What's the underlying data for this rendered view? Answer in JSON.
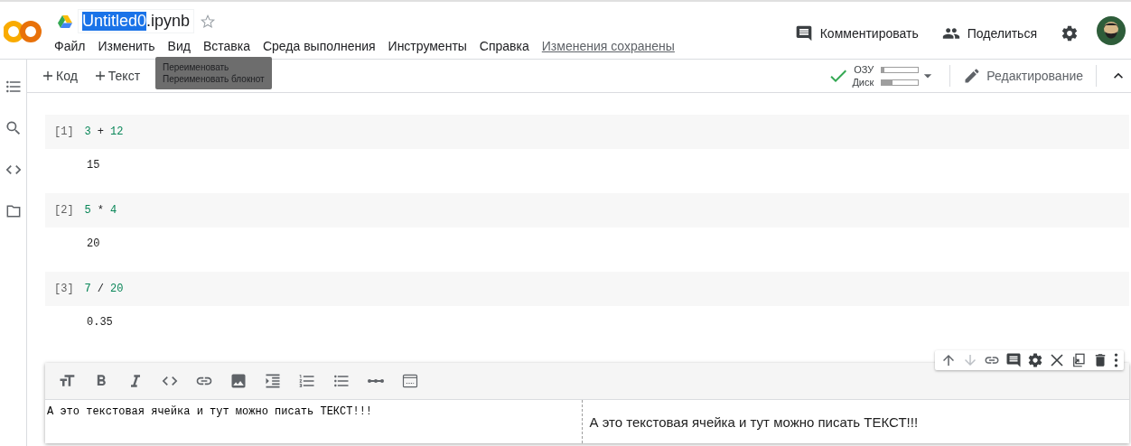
{
  "header": {
    "file_name": "Untitled0",
    "file_extension": ".ipynb",
    "name_selected": true,
    "starred": false,
    "menu": [
      "Файл",
      "Изменить",
      "Вид",
      "Вставка",
      "Среда выполнения",
      "Инструменты",
      "Справка"
    ],
    "save_status": "Изменения сохранены",
    "tooltip": [
      "Переименовать",
      "Переименовать блокнот"
    ],
    "actions": [
      {
        "kind": "comment",
        "label": "Комментировать"
      },
      {
        "kind": "share",
        "label": "Поделиться"
      }
    ]
  },
  "toolbar": {
    "add_buttons": [
      {
        "label": "Код"
      },
      {
        "label": "Текст"
      }
    ],
    "resources": [
      {
        "label": "ОЗУ",
        "level": 0.06
      },
      {
        "label": "Диск",
        "level": 0.3
      }
    ],
    "connected": true,
    "mode": "Редактирование"
  },
  "cells": [
    {
      "kind": "code",
      "counter": "[1]",
      "code": [
        {
          "t": "3",
          "kind": "number"
        },
        {
          "t": "+",
          "kind": "operator"
        },
        {
          "t": "12",
          "kind": "number"
        }
      ],
      "output": "15"
    },
    {
      "kind": "code",
      "counter": "[2]",
      "code": [
        {
          "t": "5",
          "kind": "number"
        },
        {
          "t": "*",
          "kind": "operator"
        },
        {
          "t": "4",
          "kind": "number"
        }
      ],
      "output": "20"
    },
    {
      "kind": "code",
      "counter": "[3]",
      "code": [
        {
          "t": "7",
          "kind": "number"
        },
        {
          "t": "/",
          "kind": "operator"
        },
        {
          "t": "20",
          "kind": "number"
        }
      ],
      "output": "0.35"
    },
    {
      "kind": "text",
      "source": "А это текстовая ячейка и тут можно писать ТЕКСТ!!!",
      "preview": "А это текстовая ячейка и тут можно писать ТЕКСТ!!!"
    }
  ]
}
